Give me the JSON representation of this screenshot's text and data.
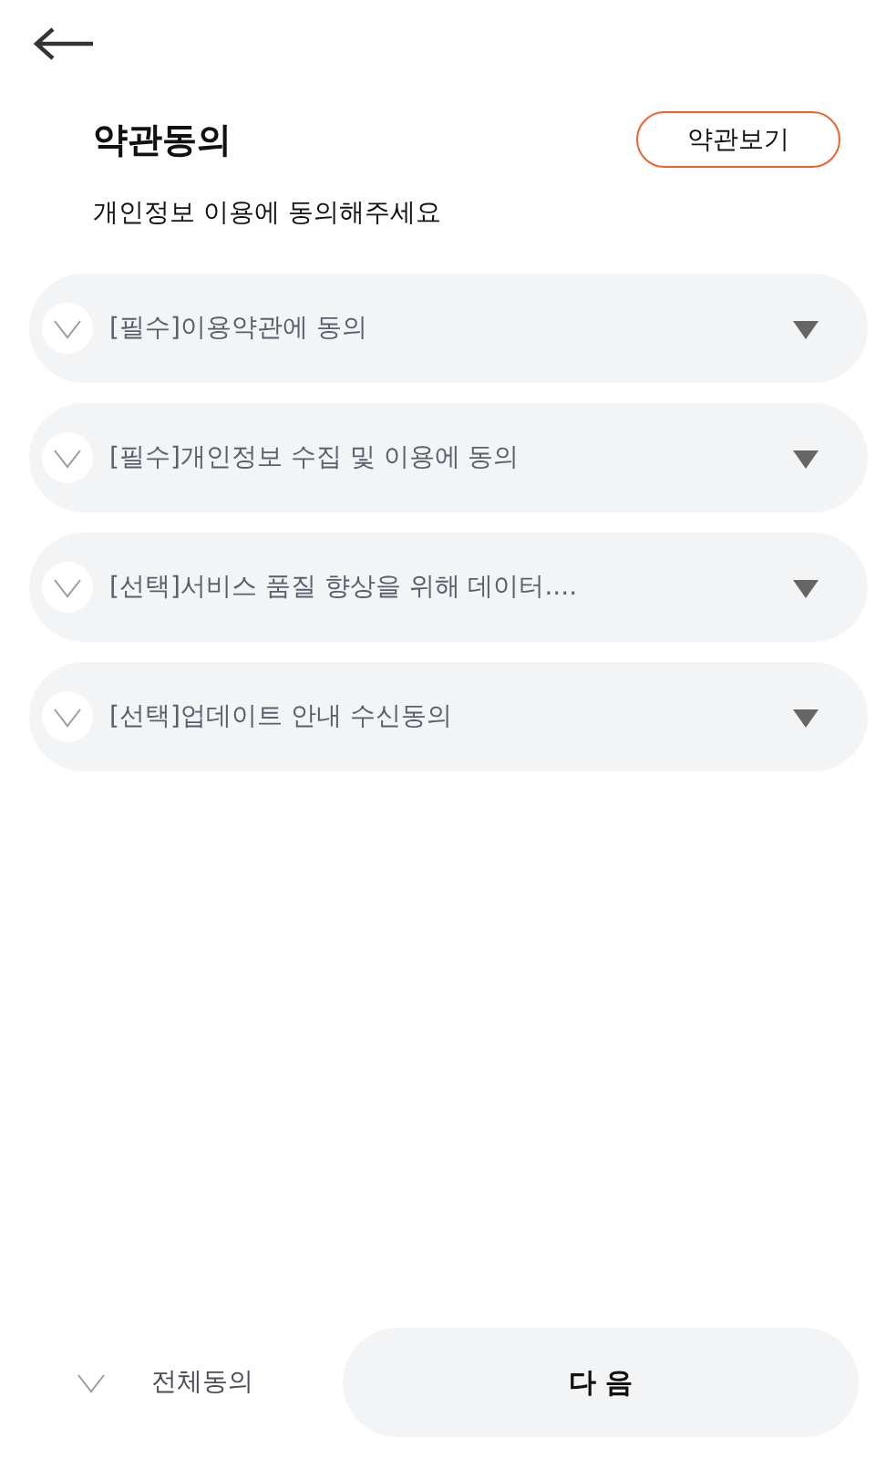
{
  "header": {
    "title": "약관동의",
    "view_terms_button": "약관보기",
    "subtitle": "개인정보 이용에 동의해주세요"
  },
  "agreements": [
    {
      "label": "[필수]이용약관에 동의",
      "checked": false,
      "expanded": false
    },
    {
      "label": "[필수]개인정보 수집 및 이용에 동의",
      "checked": false,
      "expanded": false
    },
    {
      "label": "[선택]서비스 품질 향상을 위해 데이터....",
      "checked": false,
      "expanded": false
    },
    {
      "label": "[선택]업데이트 안내 수신동의",
      "checked": false,
      "expanded": false
    }
  ],
  "footer": {
    "agree_all": {
      "label": "전체동의",
      "checked": false
    },
    "next_button": "다 음"
  }
}
